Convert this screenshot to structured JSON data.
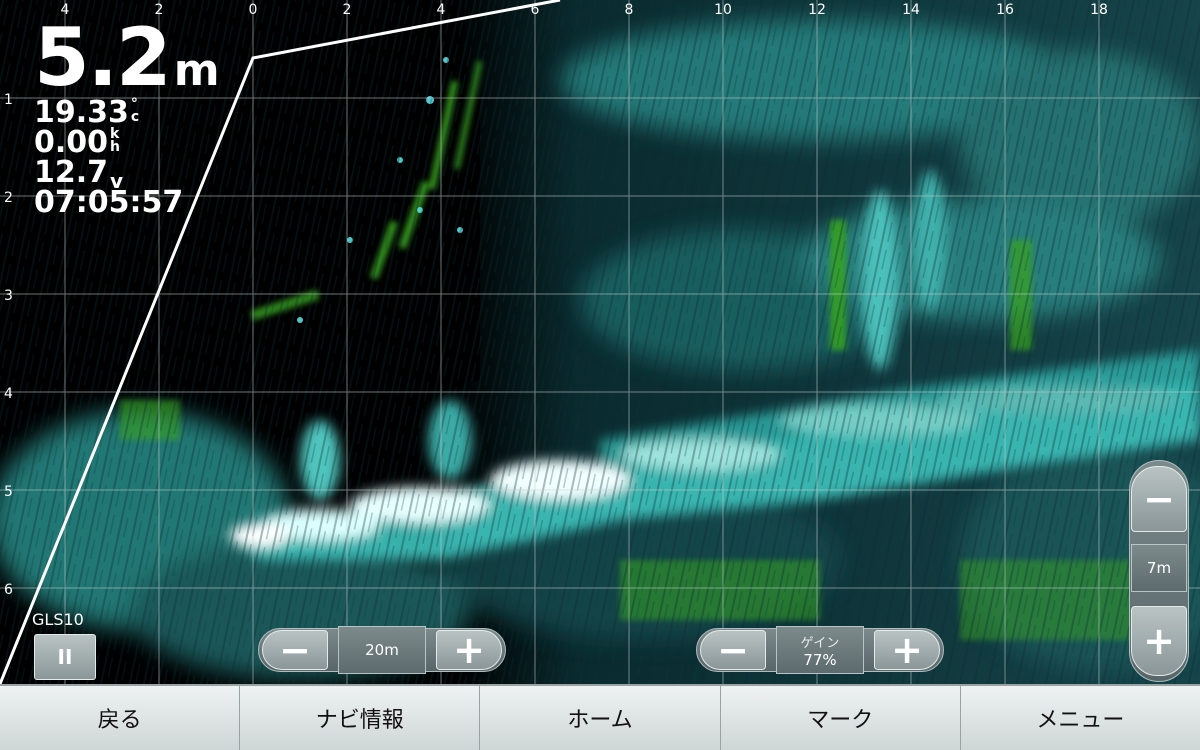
{
  "sonar": {
    "x_ticks": [
      "4",
      "2",
      "0",
      "2",
      "4",
      "6",
      "8",
      "10",
      "12",
      "14",
      "16",
      "18"
    ],
    "y_ticks": [
      "1",
      "2",
      "3",
      "4",
      "5",
      "6"
    ],
    "colors": {
      "water": "#000000",
      "return_strong": "#f2ffff",
      "return_mid": "#2fb3ad",
      "return_low": "#174f55",
      "weed": "#37a21f",
      "grid": "#c8d0d0"
    }
  },
  "readout": {
    "depth_value": "5.2",
    "depth_unit": "m",
    "temperature_value": "19.33",
    "temperature_unit_top": "°",
    "temperature_unit_bottom": "c",
    "speed_value": "0.00",
    "speed_unit_top": "k",
    "speed_unit_bottom": "h",
    "voltage_value": "12.7",
    "voltage_unit": "v",
    "time": "07:05:57"
  },
  "source": {
    "label": "GLS10",
    "pause_icon": "pause-icon",
    "pause_glyph": "II"
  },
  "range_control": {
    "minus": "−",
    "value": "20m",
    "plus": "+"
  },
  "gain_control": {
    "minus": "−",
    "label": "ゲイン",
    "value": "77%",
    "plus": "+"
  },
  "depth_control": {
    "minus": "−",
    "value": "7m",
    "plus": "+"
  },
  "nav": {
    "back": "戻る",
    "nav_info": "ナビ情報",
    "home": "ホーム",
    "mark": "マーク",
    "menu": "メニュー"
  }
}
